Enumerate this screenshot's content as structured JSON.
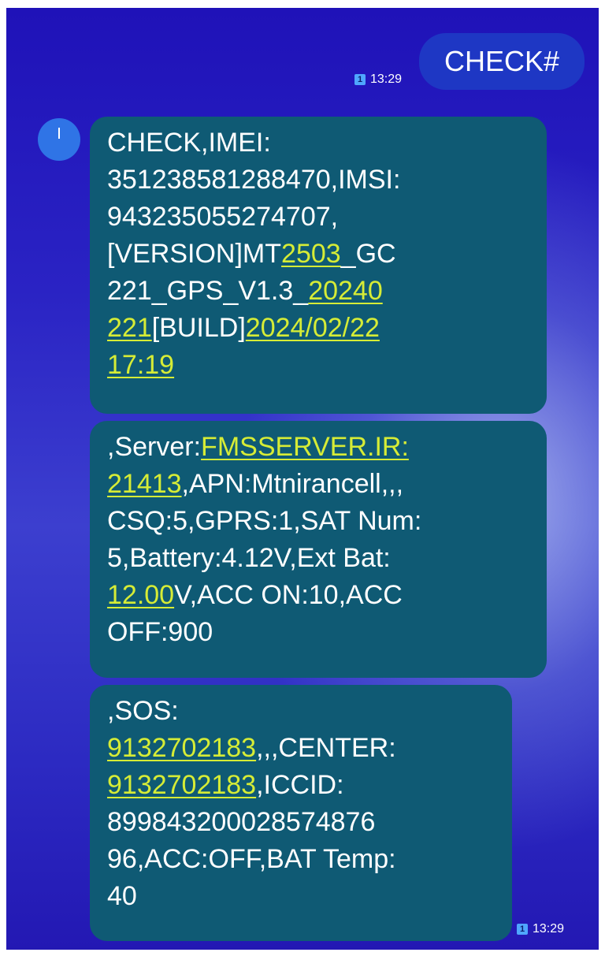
{
  "outgoing": {
    "text": "CHECK#",
    "sim": "1",
    "time": "13:29"
  },
  "incoming": {
    "time": "13:29",
    "sim": "1",
    "message1": {
      "l1": "CHECK,IMEI:",
      "l2": "3512385812884​70,IMSI:",
      "l3": "943235055274707,",
      "l4a": "[VERSION]MT",
      "l4b": "2503",
      "l4c": "_GC",
      "l5a": "221_GPS_V1.3_",
      "l5b": "20240",
      "l6a": "221",
      "l6b": "[BUILD]",
      "l6c": "2024/02/22",
      "l7": "17:19"
    },
    "message2": {
      "l1a": ",Server:",
      "l1b": "FMSSERVER.IR:",
      "l2a": "21413",
      "l2b": ",APN:Mtnirancell,,,",
      "l3": "CSQ:5,GPRS:1,SAT Num:",
      "l4": "5,Battery:4.12V,Ext Bat:",
      "l5a": "12.00",
      "l5b": "V,ACC ON:10,ACC",
      "l6": "OFF:900"
    },
    "message3": {
      "l1": ",SOS:",
      "l2a": "9132702183",
      "l2b": ",,,CENTER:",
      "l3a": "9132702183",
      "l3b": ",ICCID:",
      "l4": "89984320002857487​6",
      "l5": "96,ACC:OFF,BAT Temp:",
      "l6": "40"
    }
  }
}
